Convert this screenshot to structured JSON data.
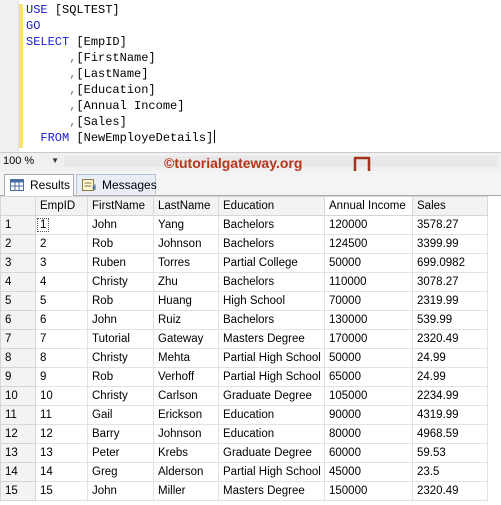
{
  "editor": {
    "lines": [
      [
        {
          "c": "kw",
          "t": "USE "
        },
        {
          "c": "id",
          "t": "[SQLTEST]"
        }
      ],
      [
        {
          "c": "kw",
          "t": "GO"
        }
      ],
      [
        {
          "c": "kw",
          "t": "SELECT "
        },
        {
          "c": "id",
          "t": "[EmpID]"
        }
      ],
      [
        {
          "c": "id",
          "t": "      "
        },
        {
          "c": "pn",
          "t": ","
        },
        {
          "c": "id",
          "t": "[FirstName]"
        }
      ],
      [
        {
          "c": "id",
          "t": "      "
        },
        {
          "c": "pn",
          "t": ","
        },
        {
          "c": "id",
          "t": "[LastName]"
        }
      ],
      [
        {
          "c": "id",
          "t": "      "
        },
        {
          "c": "pn",
          "t": ","
        },
        {
          "c": "id",
          "t": "[Education]"
        }
      ],
      [
        {
          "c": "id",
          "t": "      "
        },
        {
          "c": "pn",
          "t": ","
        },
        {
          "c": "id",
          "t": "[Annual Income]"
        }
      ],
      [
        {
          "c": "id",
          "t": "      "
        },
        {
          "c": "pn",
          "t": ","
        },
        {
          "c": "id",
          "t": "[Sales]"
        }
      ],
      [
        {
          "c": "id",
          "t": "  "
        },
        {
          "c": "kw",
          "t": "FROM "
        },
        {
          "c": "id",
          "t": "[NewEmployeDetails]"
        }
      ]
    ]
  },
  "toolbar": {
    "zoom": "100 %",
    "watermark": "©tutorialgateway.org",
    "accent_color": "#b8341a"
  },
  "tabs": [
    {
      "label": "Results",
      "icon": "grid-icon"
    },
    {
      "label": "Messages",
      "icon": "messages-icon"
    }
  ],
  "grid": {
    "columns": [
      "",
      "EmpID",
      "FirstName",
      "LastName",
      "Education",
      "Annual Income",
      "Sales"
    ],
    "rows": [
      [
        "1",
        "1",
        "John",
        "Yang",
        "Bachelors",
        "120000",
        "3578.27"
      ],
      [
        "2",
        "2",
        "Rob",
        "Johnson",
        "Bachelors",
        "124500",
        "3399.99"
      ],
      [
        "3",
        "3",
        "Ruben",
        "Torres",
        "Partial College",
        "50000",
        "699.0982"
      ],
      [
        "4",
        "4",
        "Christy",
        "Zhu",
        "Bachelors",
        "110000",
        "3078.27"
      ],
      [
        "5",
        "5",
        "Rob",
        "Huang",
        "High School",
        "70000",
        "2319.99"
      ],
      [
        "6",
        "6",
        "John",
        "Ruiz",
        "Bachelors",
        "130000",
        "539.99"
      ],
      [
        "7",
        "7",
        "Tutorial",
        "Gateway",
        "Masters Degree",
        "170000",
        "2320.49"
      ],
      [
        "8",
        "8",
        "Christy",
        "Mehta",
        "Partial High School",
        "50000",
        "24.99"
      ],
      [
        "9",
        "9",
        "Rob",
        "Verhoff",
        "Partial High School",
        "65000",
        "24.99"
      ],
      [
        "10",
        "10",
        "Christy",
        "Carlson",
        "Graduate Degree",
        "105000",
        "2234.99"
      ],
      [
        "11",
        "11",
        "Gail",
        "Erickson",
        "Education",
        "90000",
        "4319.99"
      ],
      [
        "12",
        "12",
        "Barry",
        "Johnson",
        "Education",
        "80000",
        "4968.59"
      ],
      [
        "13",
        "13",
        "Peter",
        "Krebs",
        "Graduate Degree",
        "60000",
        "59.53"
      ],
      [
        "14",
        "14",
        "Greg",
        "Alderson",
        "Partial High School",
        "45000",
        "23.5"
      ],
      [
        "15",
        "15",
        "John",
        "Miller",
        "Masters Degree",
        "150000",
        "2320.49"
      ]
    ]
  }
}
